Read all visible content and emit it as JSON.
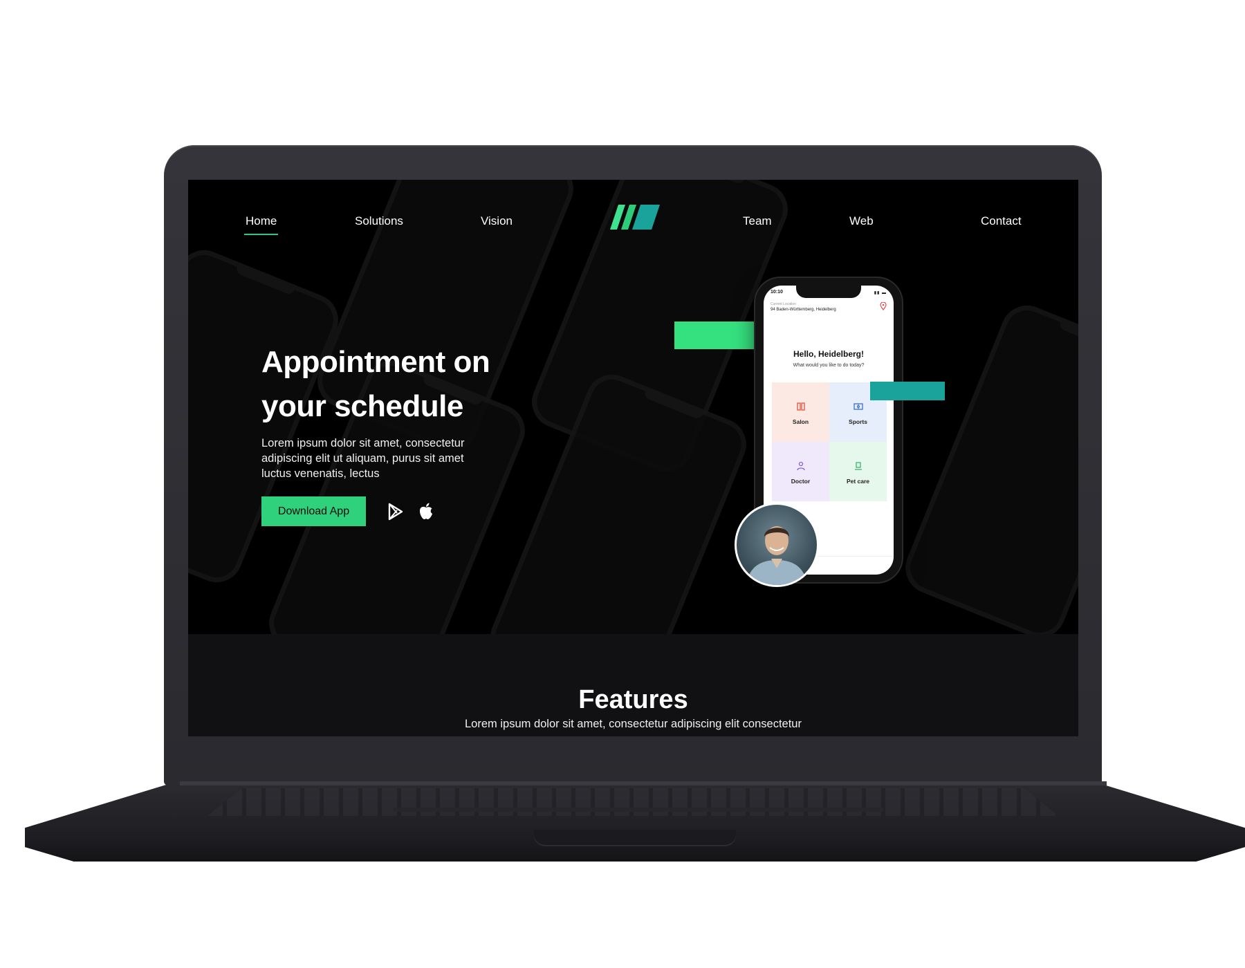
{
  "nav": {
    "items": [
      {
        "label": "Home",
        "active": true
      },
      {
        "label": "Solutions"
      },
      {
        "label": "Vision"
      },
      {
        "label": "Team"
      },
      {
        "label": "Web"
      },
      {
        "label": "Contact"
      }
    ]
  },
  "hero": {
    "title": "Appointment on your schedule",
    "subtitle": "Lorem ipsum dolor sit amet, consectetur adipiscing elit ut aliquam, purus sit amet luctus venenatis, lectus",
    "download_label": "Download App",
    "store_icons": [
      "google-play-icon",
      "apple-icon"
    ]
  },
  "phone": {
    "time": "10:10",
    "location_label": "Current Location",
    "location": "94 Baden-Württemberg, Heidelberg",
    "greeting": "Hello, Heidelberg!",
    "question": "What would you like to do today?",
    "categories": [
      {
        "label": "Salon",
        "icon": "salon-icon",
        "bg": "#fde9e3",
        "color": "#e0553f"
      },
      {
        "label": "Sports",
        "icon": "sports-icon",
        "bg": "#e7eefb",
        "color": "#3b6fd8"
      },
      {
        "label": "Doctor",
        "icon": "doctor-icon",
        "bg": "#efe9fb",
        "color": "#8a63d2"
      },
      {
        "label": "Pet care",
        "icon": "pet-care-icon",
        "bg": "#e6f8ec",
        "color": "#36b76a"
      }
    ]
  },
  "features": {
    "title": "Features",
    "subtitle": "Lorem ipsum dolor sit amet, consectetur adipiscing elit consectetur"
  },
  "colors": {
    "accent": "#2fd17d",
    "accent_teal": "#1aa39a",
    "screen_bg": "#000000",
    "laptop_body": "#2f2f35"
  }
}
